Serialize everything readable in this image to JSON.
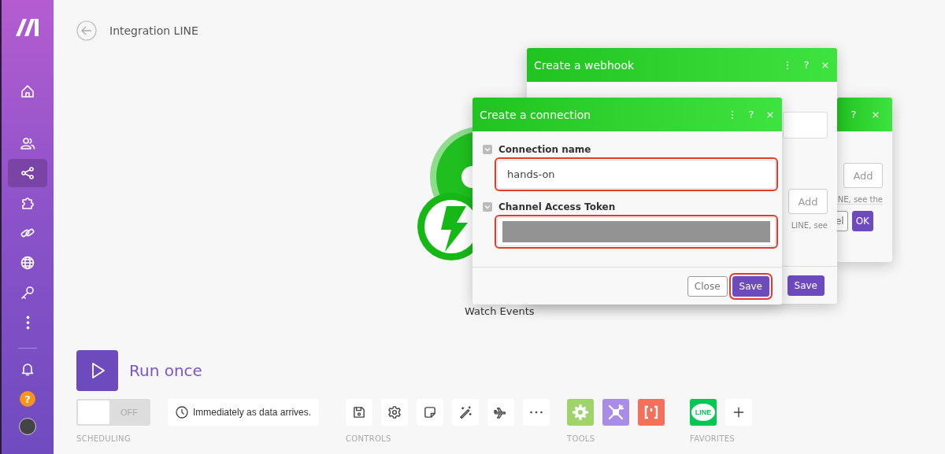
{
  "sidebar": {
    "items": [
      {
        "kind": "home",
        "selected": false
      },
      {
        "kind": "team",
        "selected": false
      },
      {
        "kind": "scenarios",
        "selected": true
      },
      {
        "kind": "apps",
        "selected": false
      },
      {
        "kind": "connections",
        "selected": false
      },
      {
        "kind": "webhooks",
        "selected": false
      },
      {
        "kind": "keys",
        "selected": false
      },
      {
        "kind": "more",
        "selected": false
      }
    ],
    "help": "?"
  },
  "header": {
    "title": "Integration LINE"
  },
  "module": {
    "label": "Watch Events"
  },
  "dialogs": [
    {
      "kind": "partial",
      "header_icons": [
        "?",
        "×"
      ],
      "add_button": "Add",
      "hint": "NE, see the",
      "buttons": [
        {
          "label": "el",
          "kind": "secondary"
        },
        {
          "label": "OK",
          "kind": "primary"
        }
      ]
    },
    {
      "kind": "webhook",
      "title": "Create a webhook",
      "header_icons": [
        "⋮",
        "?",
        "×"
      ],
      "add_button": "Add",
      "hint": "LINE, see",
      "buttons": [
        {
          "label": "Save",
          "kind": "primary"
        }
      ]
    },
    {
      "kind": "connection",
      "title": "Create a connection",
      "header_icons": [
        "⋮",
        "?",
        "×"
      ],
      "fields": [
        {
          "label": "Connection name",
          "value": "hands-on",
          "masked": false,
          "highlighted": true
        },
        {
          "label": "Channel Access Token",
          "masked": true,
          "highlighted": true
        }
      ],
      "buttons": [
        {
          "label": "Close",
          "kind": "secondary",
          "highlighted": false
        },
        {
          "label": "Save",
          "kind": "primary",
          "highlighted": true
        }
      ]
    }
  ],
  "run_once": {
    "label": "Run once"
  },
  "scheduling": {
    "on": false,
    "toggle_label": "OFF",
    "caption": "SCHEDULING",
    "schedule": "Immediately as data arrives."
  },
  "controls": {
    "caption": "CONTROLS",
    "items": [
      {
        "kind": "save"
      },
      {
        "kind": "settings"
      },
      {
        "kind": "note"
      },
      {
        "kind": "wand"
      },
      {
        "kind": "airplane"
      },
      {
        "kind": "more"
      }
    ]
  },
  "tools": {
    "caption": "TOOLS",
    "items": [
      {
        "kind": "gear",
        "color": "#9fd46d"
      },
      {
        "kind": "tools",
        "color": "#a98ce6"
      },
      {
        "kind": "brackets",
        "color": "#f5705a"
      }
    ]
  },
  "favorites": {
    "caption": "FAVORITES",
    "items": [
      {
        "kind": "line",
        "label": "LINE"
      },
      {
        "kind": "add"
      }
    ]
  }
}
